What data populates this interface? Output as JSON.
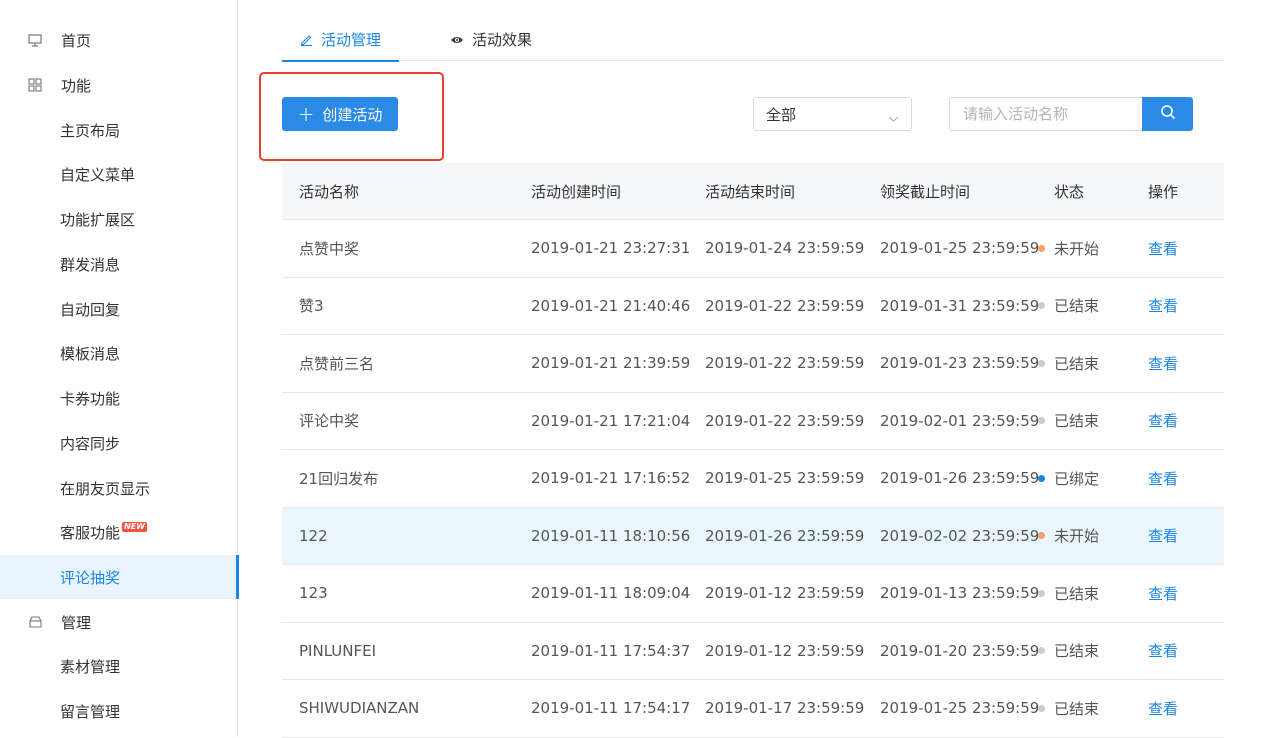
{
  "sidebar": {
    "items": [
      {
        "label": "首页",
        "type": "top",
        "icon": "monitor-icon"
      },
      {
        "label": "功能",
        "type": "top",
        "icon": "grid-icon"
      },
      {
        "label": "主页布局",
        "type": "sub"
      },
      {
        "label": "自定义菜单",
        "type": "sub"
      },
      {
        "label": "功能扩展区",
        "type": "sub"
      },
      {
        "label": "群发消息",
        "type": "sub"
      },
      {
        "label": "自动回复",
        "type": "sub"
      },
      {
        "label": "模板消息",
        "type": "sub"
      },
      {
        "label": "卡券功能",
        "type": "sub"
      },
      {
        "label": "内容同步",
        "type": "sub"
      },
      {
        "label": "在朋友页显示",
        "type": "sub"
      },
      {
        "label": "客服功能",
        "type": "sub",
        "badge": "NEW"
      },
      {
        "label": "评论抽奖",
        "type": "sub",
        "active": true
      },
      {
        "label": "管理",
        "type": "top",
        "icon": "box-icon"
      },
      {
        "label": "素材管理",
        "type": "sub"
      },
      {
        "label": "留言管理",
        "type": "sub"
      }
    ]
  },
  "tabs": [
    {
      "label": "活动管理",
      "icon": "pencil-icon",
      "active": true
    },
    {
      "label": "活动效果",
      "icon": "eye-icon",
      "active": false
    }
  ],
  "toolbar": {
    "create_label": "创建活动",
    "filter_value": "全部",
    "search_placeholder": "请输入活动名称"
  },
  "table": {
    "columns": [
      "活动名称",
      "活动创建时间",
      "活动结束时间",
      "领奖截止时间",
      "状态",
      "操作"
    ],
    "rows": [
      {
        "name": "点赞中奖",
        "created": "2019-01-21 23:27:31",
        "end": "2019-01-24 23:59:59",
        "deadline": "2019-01-25 23:59:59",
        "status": "未开始",
        "status_color": "#f5a16b",
        "action": "查看"
      },
      {
        "name": "赞3",
        "created": "2019-01-21 21:40:46",
        "end": "2019-01-22 23:59:59",
        "deadline": "2019-01-31 23:59:59",
        "status": "已结束",
        "status_color": "#cccccc",
        "action": "查看"
      },
      {
        "name": "点赞前三名",
        "created": "2019-01-21 21:39:59",
        "end": "2019-01-22 23:59:59",
        "deadline": "2019-01-23 23:59:59",
        "status": "已结束",
        "status_color": "#cccccc",
        "action": "查看"
      },
      {
        "name": "评论中奖",
        "created": "2019-01-21 17:21:04",
        "end": "2019-01-22 23:59:59",
        "deadline": "2019-02-01 23:59:59",
        "status": "已结束",
        "status_color": "#cccccc",
        "action": "查看"
      },
      {
        "name": "21回归发布",
        "created": "2019-01-21 17:16:52",
        "end": "2019-01-25 23:59:59",
        "deadline": "2019-01-26 23:59:59",
        "status": "已绑定",
        "status_color": "#1a86e6",
        "action": "查看"
      },
      {
        "name": "122",
        "created": "2019-01-11 18:10:56",
        "end": "2019-01-26 23:59:59",
        "deadline": "2019-02-02 23:59:59",
        "status": "未开始",
        "status_color": "#f5a16b",
        "action": "查看",
        "hover": true
      },
      {
        "name": "123",
        "created": "2019-01-11 18:09:04",
        "end": "2019-01-12 23:59:59",
        "deadline": "2019-01-13 23:59:59",
        "status": "已结束",
        "status_color": "#cccccc",
        "action": "查看"
      },
      {
        "name": "PINLUNFEI",
        "created": "2019-01-11 17:54:37",
        "end": "2019-01-12 23:59:59",
        "deadline": "2019-01-20 23:59:59",
        "status": "已结束",
        "status_color": "#cccccc",
        "action": "查看"
      },
      {
        "name": "SHIWUDIANZAN",
        "created": "2019-01-11 17:54:17",
        "end": "2019-01-17 23:59:59",
        "deadline": "2019-01-25 23:59:59",
        "status": "已结束",
        "status_color": "#cccccc",
        "action": "查看"
      }
    ]
  },
  "colors": {
    "accent": "#1a86e6",
    "highlight": "#e8402f"
  }
}
